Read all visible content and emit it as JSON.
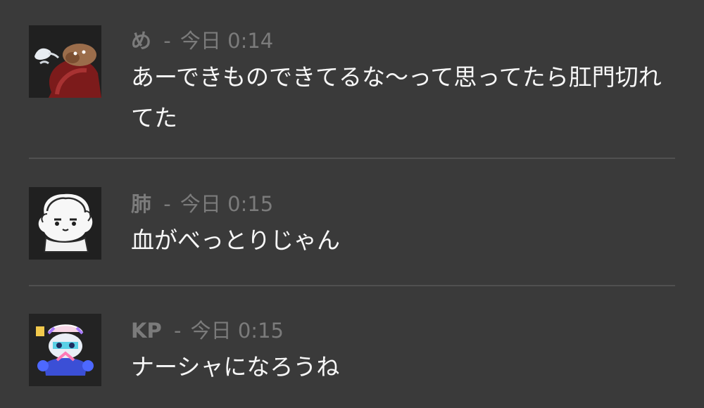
{
  "messages": [
    {
      "author": "め",
      "separator": "-",
      "timestamp": "今日 0:14",
      "content": "あーできものできてるな〜って思ってたら肛門切れてた"
    },
    {
      "author": "肺",
      "separator": "-",
      "timestamp": "今日 0:15",
      "content": "血がべっとりじゃん"
    },
    {
      "author": "KP",
      "separator": "-",
      "timestamp": "今日 0:15",
      "content": "ナーシャになろうね"
    }
  ],
  "colors": {
    "background": "#3a3a3a",
    "author": "#7b7b7b",
    "message_text": "#f7f7f7",
    "divider": "#505050"
  },
  "icons": {
    "avatar_1": "brown-creature-avatar-icon",
    "avatar_2": "sketch-character-avatar-icon",
    "avatar_3": "colorful-robot-avatar-icon"
  }
}
